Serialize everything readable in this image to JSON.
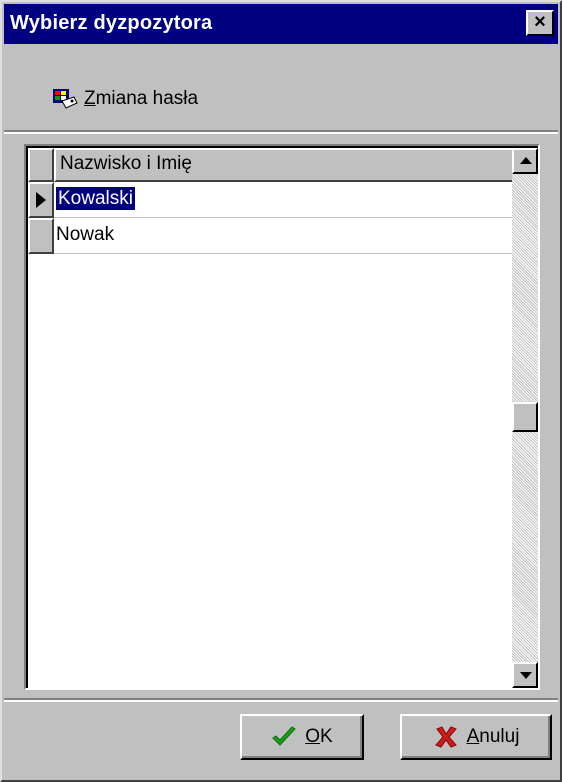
{
  "window": {
    "title": "Wybierz dyzpozytora",
    "close_glyph": "×"
  },
  "toolbar": {
    "change_password_label": "Zmiana hasła",
    "change_password_icon": "key-card-icon"
  },
  "grid": {
    "column_header": "Nazwisko i Imię",
    "rows": [
      {
        "name": "Kowalski",
        "selected": true
      },
      {
        "name": "Nowak",
        "selected": false
      }
    ]
  },
  "buttons": {
    "ok_label": "OK",
    "cancel_label": "Anuluj",
    "ok_icon": "checkmark-icon",
    "cancel_icon": "x-icon"
  },
  "colors": {
    "titlebar": "#000080",
    "face": "#c0c0c0",
    "selection": "#000080",
    "ok_green": "#1a9f1a",
    "cancel_red": "#d11a1a"
  }
}
